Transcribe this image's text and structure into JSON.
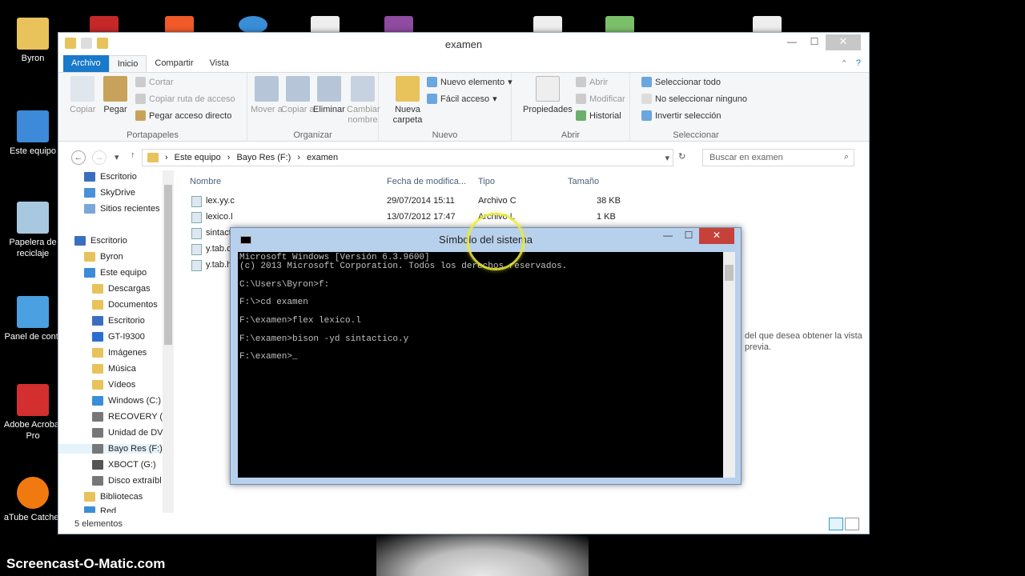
{
  "desktop": {
    "icons": [
      {
        "label": "Byron",
        "color": "#e8c25a"
      },
      {
        "label": "Este equipo",
        "color": "#3c8ad8"
      },
      {
        "label": "Papelera de reciclaje",
        "color": "#a8c8e0"
      },
      {
        "label": "Panel de contr",
        "color": "#4aa0e0"
      },
      {
        "label": "Adobe Acrobat Pro",
        "color": "#d32f2f"
      },
      {
        "label": "aTube Catcher",
        "color": "#f07a10"
      }
    ],
    "watermark": "Screencast-O-Matic.com"
  },
  "explorer": {
    "title": "examen",
    "tabs": [
      "Archivo",
      "Inicio",
      "Compartir",
      "Vista"
    ],
    "ribbon": {
      "portapapeles": {
        "label": "Portapapeles",
        "copiar": "Copiar",
        "pegar": "Pegar",
        "cortar": "Cortar",
        "copiar_ruta": "Copiar ruta de acceso",
        "pegar_acceso": "Pegar acceso directo"
      },
      "organizar": {
        "label": "Organizar",
        "mover": "Mover a",
        "copiar": "Copiar a",
        "eliminar": "Eliminar",
        "cambiar": "Cambiar nombre"
      },
      "nuevo": {
        "label": "Nuevo",
        "nueva_carpeta": "Nueva carpeta",
        "nuevo_elemento": "Nuevo elemento",
        "facil_acceso": "Fácil acceso"
      },
      "abrir": {
        "label": "Abrir",
        "propiedades": "Propiedades",
        "abrir": "Abrir",
        "modificar": "Modificar",
        "historial": "Historial"
      },
      "seleccionar": {
        "label": "Seleccionar",
        "todo": "Seleccionar todo",
        "ninguno": "No seleccionar ninguno",
        "invertir": "Invertir selección"
      }
    },
    "address": {
      "parts": [
        "Este equipo",
        "Bayo Res (F:)",
        "examen"
      ],
      "search_placeholder": "Buscar en examen"
    },
    "nav": [
      "Escritorio",
      "SkyDrive",
      "Sitios recientes",
      "Escritorio",
      "Byron",
      "Este equipo",
      "Descargas",
      "Documentos",
      "Escritorio",
      "GT-I9300",
      "Imágenes",
      "Música",
      "Vídeos",
      "Windows (C:)",
      "RECOVERY (D",
      "Unidad de DV",
      "Bayo Res (F:)",
      "XBOCT (G:)",
      "Disco extraíbl",
      "Bibliotecas",
      "Red"
    ],
    "columns": [
      "Nombre",
      "Fecha de modifica...",
      "Tipo",
      "Tamaño"
    ],
    "files": [
      {
        "name": "lex.yy.c",
        "date": "29/07/2014 15:11",
        "type": "Archivo C",
        "size": "38 KB"
      },
      {
        "name": "lexico.l",
        "date": "13/07/2012 17:47",
        "type": "Archivo L",
        "size": "1 KB"
      },
      {
        "name": "sintact",
        "date": "",
        "type": "",
        "size": ""
      },
      {
        "name": "y.tab.c",
        "date": "",
        "type": "",
        "size": ""
      },
      {
        "name": "y.tab.h",
        "date": "",
        "type": "",
        "size": ""
      }
    ],
    "preview_hint": "del que desea obtener la vista previa.",
    "status": "5 elementos"
  },
  "cmd": {
    "title": "Símbolo del sistema",
    "lines": [
      "Microsoft Windows [Versión 6.3.9600]",
      "(c) 2013 Microsoft Corporation. Todos los derechos reservados.",
      "",
      "C:\\Users\\Byron>f:",
      "",
      "F:\\>cd examen",
      "",
      "F:\\examen>flex lexico.l",
      "",
      "F:\\examen>bison -yd sintactico.y",
      "",
      "F:\\examen>_"
    ]
  }
}
